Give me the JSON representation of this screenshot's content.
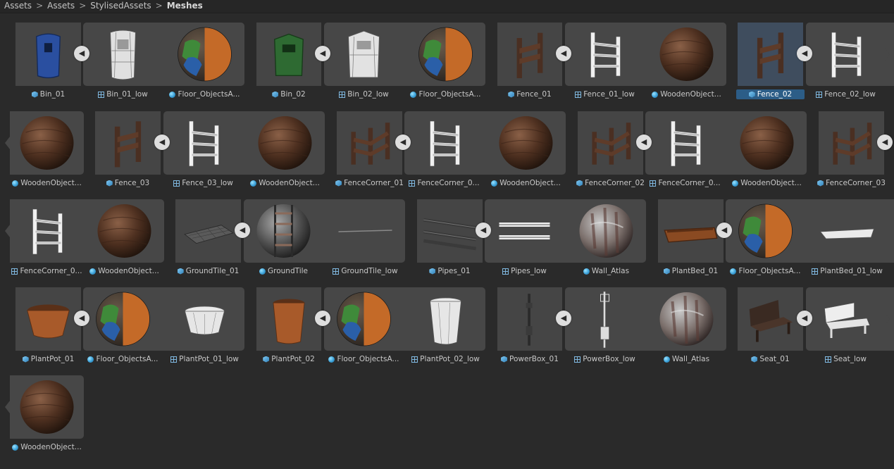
{
  "breadcrumb": {
    "items": [
      "Assets",
      "Assets",
      "StylisedAssets"
    ],
    "current": "Meshes",
    "separator": ">"
  },
  "labels": {
    "r1": [
      "Bin_01",
      "Bin_01_low",
      "Floor_ObjectsA...",
      "Bin_02",
      "Bin_02_low",
      "Floor_ObjectsA...",
      "Fence_01",
      "Fence_01_low",
      "WoodenObject...",
      "Fence_02",
      "Fence_02_low"
    ],
    "r2": [
      "WoodenObject...",
      "Fence_03",
      "Fence_03_low",
      "WoodenObject...",
      "FenceCorner_01",
      "FenceCorner_0...",
      "WoodenObject...",
      "FenceCorner_02",
      "FenceCorner_0...",
      "WoodenObject...",
      "FenceCorner_03"
    ],
    "r3": [
      "FenceCorner_0...",
      "WoodenObject...",
      "GroundTile_01",
      "GroundTile",
      "GroundTile_low",
      "Pipes_01",
      "Pipes_low",
      "Wall_Atlas",
      "PlantBed_01",
      "Floor_ObjectsA...",
      "PlantBed_01_low"
    ],
    "r4": [
      "PlantPot_01",
      "Floor_ObjectsA...",
      "PlantPot_01_low",
      "PlantPot_02",
      "Floor_ObjectsA...",
      "PlantPot_02_low",
      "PowerBox_01",
      "PowerBox_low",
      "Wall_Atlas",
      "Seat_01",
      "Seat_low"
    ],
    "r5": [
      "WoodenObject..."
    ]
  },
  "icons": {
    "prefab": "prefab-cube-icon",
    "mesh": "mesh-grid-icon",
    "material": "material-sphere-icon",
    "collapse": "collapse-arrow-icon"
  },
  "selected": "Fence_02",
  "colors": {
    "selection": "#2c5d87",
    "background": "#2a2a2a"
  }
}
